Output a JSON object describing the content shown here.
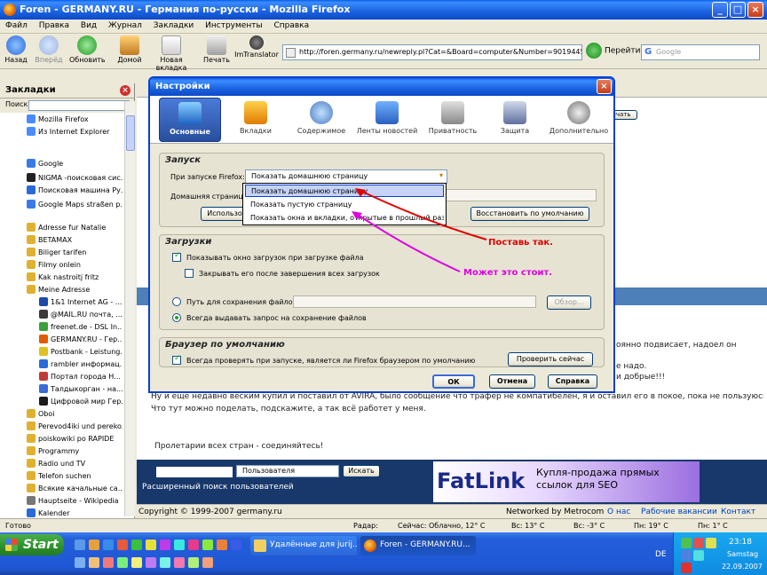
{
  "window": {
    "title": "Foren - GERMANY.RU - Германия по-русски - Mozilla Firefox"
  },
  "menu": [
    "Файл",
    "Правка",
    "Вид",
    "Журнал",
    "Закладки",
    "Инструменты",
    "Справка"
  ],
  "toolbar": {
    "back": "Назад",
    "forward": "Вперёд",
    "reload": "Обновить",
    "home": "Домой",
    "newtab": "Новая вкладка",
    "print": "Печать",
    "translator": "ImTranslator",
    "url": "http://foren.germany.ru/newreply.pl?Cat=&Board=computer&Number=90194458(",
    "go": "Перейти",
    "search_placeholder": "Google"
  },
  "sidebar": {
    "title": "Закладки",
    "search_label": "Поиск:",
    "items": [
      "Mozilla Firefox",
      "Из Internet Explorer",
      "Google",
      "NIGMA -поисковая сис...",
      "Поисковая машина Ру...",
      "Google Maps straßen p...",
      "Adresse fur Natalie",
      "BETAMAX",
      "Biliger tarifen",
      "Filmy onlein",
      "Kak nastroitj fritz",
      "Meine Adresse",
      "1&1 Internet AG - ...",
      "@MAIL.RU почта, ...",
      "freenet.de - DSL In...",
      "GERMANY.RU - Гер...",
      "Postbank - Leistung...",
      "rambler информац...",
      "Портал города Н...",
      "Талдыкорган - на...",
      "Цифровой мир Гер...",
      "Oboi",
      "Perevod4iki und pereko...",
      "poiskowiki po RAPIDE",
      "Programmy",
      "Radio und TV",
      "Telefon suchen",
      "Всякие качальные са...",
      "Hauptseite - Wikipedia",
      "Kalender",
      "p2p-world VOYIKP"
    ]
  },
  "page": {
    "line1": "оянно подвисает, надоел он",
    "line2": "е надо.",
    "line3": "и добрые!!!",
    "line4": "Ну и ещё недавно веским купил и поставил от AVIRA, было сообщение что трафер не компатибелен, я и оставил его в покое, пока не пользуюсь.",
    "line5": "Что тут можно поделать, подскажите, а так всё работет у меня.",
    "signature": "Пролетарии всех стран - соединяйтесь!",
    "user_select": "Пользователя",
    "search_btn": "Искать",
    "ext_search": "Расширенный поиск пользователей",
    "ad_logo": "FatLink",
    "ad_slogan": "Купля-продажа прямых ссылок для SEO",
    "copyright": "Copyright © 1999-2007 germany.ru",
    "networked": "Networked by Metrocom",
    "about": "О нас",
    "jobs": "Рабочие вакансии",
    "contact": "Контакт",
    "reply_btn": "ечать"
  },
  "dialog": {
    "title": "Настройки",
    "categories": [
      "Основные",
      "Вкладки",
      "Содержимое",
      "Ленты новостей",
      "Приватность",
      "Защита",
      "Дополнительно"
    ],
    "startup": {
      "header": "Запуск",
      "label": "При запуске Firefox:",
      "selected": "Показать домашнюю страницу",
      "home_label": "Домашняя страница:",
      "btn_use": "Использо",
      "btn_restore": "Восстановить по умолчанию",
      "options": [
        "Показать домашнюю страницу",
        "Показать пустую страницу",
        "Показать окна и вкладки, открытые в прошлый раз"
      ]
    },
    "downloads": {
      "header": "Загрузки",
      "show_window": "Показывать окно загрузок при загрузке файла",
      "close_after": "Закрывать его после завершения всех загрузок",
      "save_path": "Путь для сохранения файлов",
      "browse": "Обзор...",
      "always_ask": "Всегда выдавать запрос на сохранение файлов"
    },
    "default_browser": {
      "header": "Браузер по умолчанию",
      "check": "Всегда проверять при запуске, является ли Firefox браузером по умолчанию",
      "check_now": "Проверить сейчас"
    },
    "ok": "ОК",
    "cancel": "Отмена",
    "help": "Справка"
  },
  "annotations": {
    "red": "Поставь так.",
    "magenta": "Может это стоит."
  },
  "statusbar": {
    "done": "Готово",
    "radar": "Радар:",
    "weather_now": "Сейчас: Облачно, 12° C",
    "sun": "Вс: 13° C",
    "sun_night": "Вс: -3° C",
    "mon": "Пн: 19° C",
    "mon_night": "Пн: 1° C"
  },
  "taskbar": {
    "start": "Start",
    "task1": "Удалённые для jurij...",
    "task2": "Foren - GERMANY.RU...",
    "lang": "DE",
    "time": "23:18",
    "day": "Samstag",
    "date": "22.09.2007"
  },
  "colors": {
    "annotation_red": "#e00000",
    "annotation_magenta": "#e000e0",
    "xp_blue": "#245edb"
  }
}
